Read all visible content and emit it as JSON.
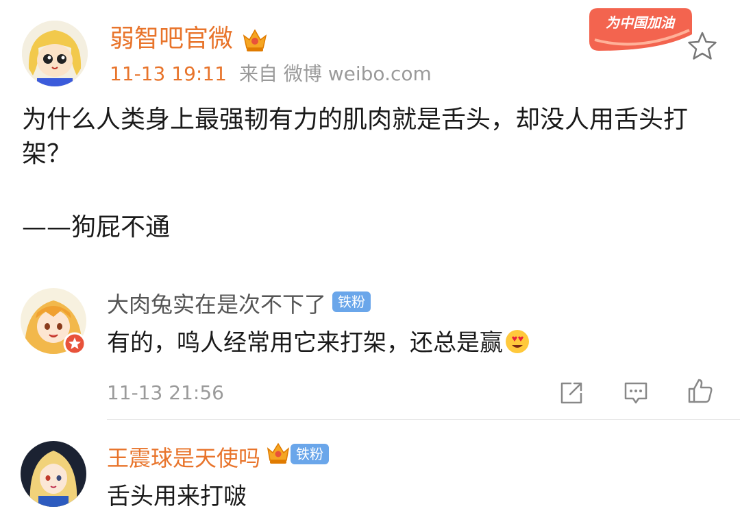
{
  "post": {
    "author": "弱智吧官微",
    "time": "11-13 19:11",
    "source": "来自 微博 weibo.com",
    "badge_text": "为中国加油",
    "text": "为什么人类身上最强韧有力的肌肉就是舌头，却没人用舌头打架？",
    "signature": "——狗屁不通"
  },
  "comments": [
    {
      "name": "大肉兔实在是次不下了",
      "tag": "铁粉",
      "text": "有的，鸣人经常用它来打架，还总是赢",
      "time": "11-13 21:56"
    },
    {
      "name": "王震球是天使吗",
      "tag": "铁粉",
      "text": "舌头用来打啵"
    }
  ],
  "colors": {
    "accent_orange": "#e8742b",
    "meta_gray": "#9a9a9a",
    "tag_blue": "#6aa6ea"
  }
}
